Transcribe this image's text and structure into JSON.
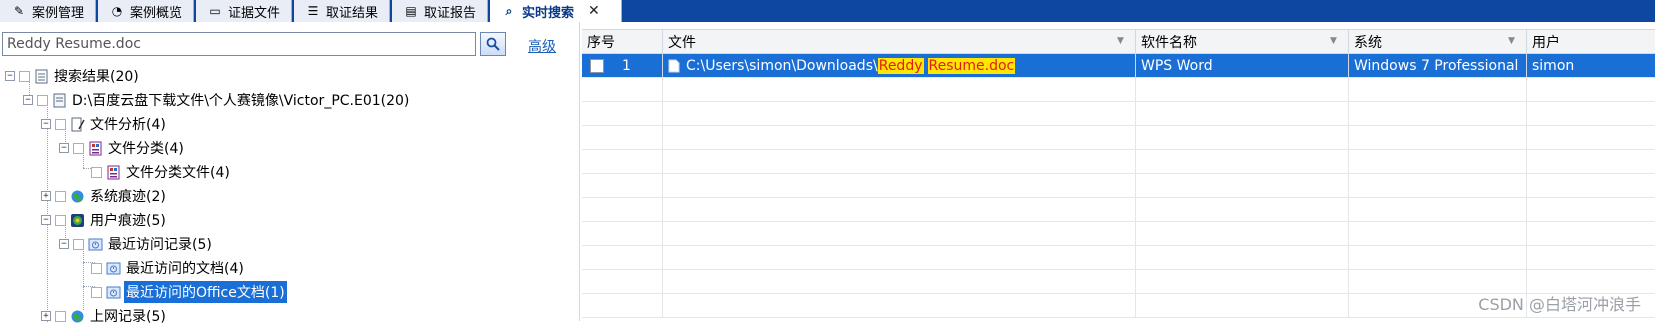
{
  "tabs": [
    {
      "label": "案例管理",
      "icon": "case-manage-icon",
      "active": false
    },
    {
      "label": "案例概览",
      "icon": "overview-icon",
      "active": false
    },
    {
      "label": "证据文件",
      "icon": "evidence-file-icon",
      "active": false
    },
    {
      "label": "取证结果",
      "icon": "forensic-result-icon",
      "active": false
    },
    {
      "label": "取证报告",
      "icon": "report-icon",
      "active": false
    },
    {
      "label": "实时搜索",
      "icon": "search-icon",
      "active": true
    }
  ],
  "search": {
    "value": "Reddy Resume.doc",
    "advanced_label": "高级"
  },
  "tree": [
    {
      "label": "搜索结果(20)",
      "toggle": "⊟"
    },
    {
      "label": "D:\\百度云盘下载文件\\个人赛镜像\\Victor_PC.E01(20)",
      "toggle": "⊟"
    },
    {
      "label": "文件分析(4)",
      "toggle": "⊟"
    },
    {
      "label": "文件分类(4)",
      "toggle": "⊟"
    },
    {
      "label": "文件分类文件(4)",
      "toggle": ""
    },
    {
      "label": "系统痕迹(2)",
      "toggle": "⊞"
    },
    {
      "label": "用户痕迹(5)",
      "toggle": "⊟"
    },
    {
      "label": "最近访问记录(5)",
      "toggle": "⊟"
    },
    {
      "label": "最近访问的文档(4)",
      "toggle": ""
    },
    {
      "label": "最近访问的Office文档(1)",
      "toggle": ""
    },
    {
      "label": "上网记录(5)",
      "toggle": "⊞"
    }
  ],
  "grid": {
    "columns": [
      "序号",
      "文件",
      "软件名称",
      "系统",
      "用户"
    ],
    "rows": [
      {
        "index": "1",
        "path_prefix": "C:\\Users\\simon\\Downloads\\",
        "path_hl1": "Reddy",
        "path_hl2": "Resume.doc",
        "software": "WPS Word",
        "system": "Windows 7 Professional",
        "user": "simon"
      }
    ]
  },
  "watermark": "CSDN @白塔河冲浪手"
}
